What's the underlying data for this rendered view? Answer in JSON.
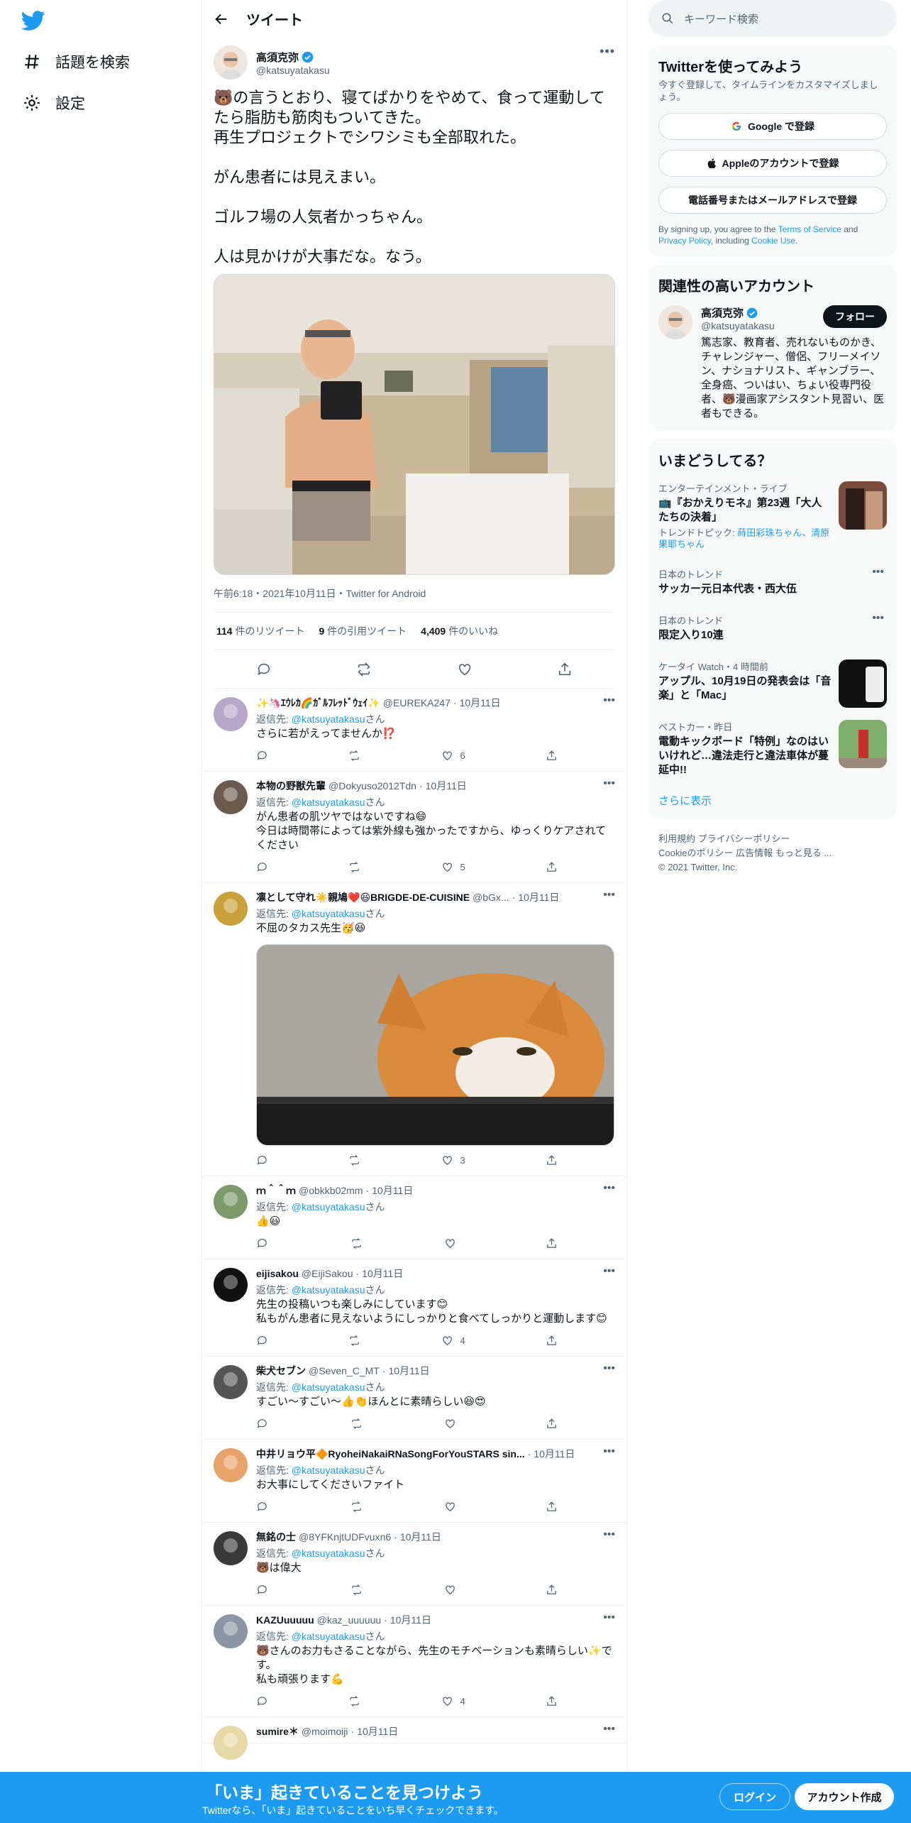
{
  "nav": {
    "explore": "話題を検索",
    "settings": "設定"
  },
  "header": {
    "title": "ツイート"
  },
  "tweet": {
    "name": "高須克弥",
    "handle": "@katsuyatakasu",
    "text": "🐻の言うとおり、寝てばかりをやめて、食って運動してたら脂肪も筋肉もついてきた。\n再生プロジェクトでシワシミも全部取れた。\n\nがん患者には見えまい。\n\nゴルフ場の人気者かっちゃん。\n\n人は見かけが大事だな。なう。",
    "meta": "午前6:18・2021年10月11日・Twitter for Android",
    "stats": {
      "retweets_num": "114",
      "retweets_label": " 件のリツイート",
      "quotes_num": "9",
      "quotes_label": " 件の引用ツイート",
      "likes_num": "4,409",
      "likes_label": " 件のいいね"
    }
  },
  "reply_to_label": "返信先: ",
  "reply_to_handle": "@katsuyatakasu",
  "reply_to_suffix": "さん",
  "replies": [
    {
      "name": "✨🦄ｴｳﾚｶ🌈ｶﾞﾙﾌﾚｯﾄﾞｳｪｲ✨",
      "handle": "@EUREKA247",
      "date": "10月11日",
      "text": "さらに若がえってませんか⁉️",
      "likes": "6"
    },
    {
      "name": "本物の野獣先輩",
      "handle": "@Dokyuso2012Tdn",
      "date": "10月11日",
      "text": "がん患者の肌ツヤではないですね😄\n今日は時間帯によっては紫外線も強かったですから、ゆっくりケアされてください",
      "likes": "5"
    },
    {
      "name": "凛として守れ☀️親鳩❤️😆BRIGDE-DE-CUISINE",
      "handle": "@bGx...",
      "date": "10月11日",
      "text": "不屈のタカス先生🥳😆",
      "likes": "3"
    },
    {
      "name": "ｍ＾＾ｍ",
      "handle": "@obkkb02mm",
      "date": "10月11日",
      "text": "👍😃",
      "likes": ""
    },
    {
      "name": "eijisakou",
      "handle": "@EijiSakou",
      "date": "10月11日",
      "text": "先生の投稿いつも楽しみにしています😊\n私もがん患者に見えないようにしっかりと食べてしっかりと運動します😊",
      "likes": "4"
    },
    {
      "name": "柴犬セブン",
      "handle": "@Seven_C_MT",
      "date": "10月11日",
      "text": "すごい～すごい～👍👏ほんとに素晴らしい😆😍",
      "likes": ""
    },
    {
      "name": "中井リョウ平🔶RyoheiNakaiRNaSongForYouSTARS sin...",
      "handle": "",
      "date": "10月11日",
      "text": "お大事にしてくださいファイト",
      "likes": ""
    },
    {
      "name": "無銘の士",
      "handle": "@8YFKnjtUDFvuxn6",
      "date": "10月11日",
      "text": "🐻は偉大",
      "likes": ""
    },
    {
      "name": "KAZUuuuuu",
      "handle": "@kaz_uuuuuu",
      "date": "10月11日",
      "text": "🐻さんのお力もさることながら、先生のモチベーションも素晴らしい✨です。\n私も頑張ります💪",
      "likes": "4"
    },
    {
      "name": "sumire＊",
      "handle": "@moimoiji",
      "date": "10月11日",
      "text": "",
      "likes": ""
    }
  ],
  "search": {
    "placeholder": "キーワード検索"
  },
  "signup": {
    "title": "Twitterを使ってみよう",
    "subtitle": "今すぐ登録して、タイムラインをカスタマイズしましょう。",
    "google": "Google で登録",
    "apple": "Appleのアカウントで登録",
    "phone": "電話番号またはメールアドレスで登録",
    "legal_prefix": "By signing up, you agree to the ",
    "terms": "Terms of Service",
    "and": " and ",
    "privacy": "Privacy Policy",
    "including": ", including ",
    "cookie": "Cookie Use",
    "period": "."
  },
  "related": {
    "title": "関連性の高いアカウント",
    "name": "高須克弥",
    "handle": "@katsuyatakasu",
    "follow": "フォロー",
    "bio": "篤志家、教育者、売れないものかき、チャレンジャー、僧侶、フリーメイソン、ナショナリスト、ギャンブラー、全身癌、ついはい、ちょい役専門役者、🐻漫画家アシスタント見習い、医者もできる。"
  },
  "trends": {
    "title": "いまどうしてる？",
    "items": [
      {
        "ctx": "エンターテインメント・ライブ",
        "title": "📺『おかえりモネ』第23週「大人たちの決着」",
        "topic_label": "トレンドトピック: ",
        "topic": "蒔田彩珠ちゃん、清原果耶ちゃん"
      },
      {
        "ctx": "日本のトレンド",
        "title": "サッカー元日本代表・西大伍"
      },
      {
        "ctx": "日本のトレンド",
        "title": "限定入り10連"
      },
      {
        "source": "ケータイ Watch",
        "time": "・4 時間前",
        "title": "アップル、10月19日の発表会は「音楽」と「Mac」"
      },
      {
        "source": "ベストカー",
        "time": "・昨日",
        "title": "電動キックボード「特例」なのはいいけれど…違法走行と違法車体が蔓延中!!"
      }
    ],
    "more": "さらに表示"
  },
  "footer": {
    "line1": "利用規約   プライバシーポリシー",
    "line2": "Cookieのポリシー   広告情報   もっと見る ...",
    "line3": "© 2021 Twitter, Inc."
  },
  "bottom": {
    "title": "「いま」起きていることを見つけよう",
    "subtitle": "Twitterなら、「いま」起きていることをいち早くチェックできます。",
    "login": "ログイン",
    "signup": "アカウント作成"
  },
  "colors": {
    "accent": "#1d9bf0",
    "text": "#0f1419",
    "muted": "#536471"
  }
}
